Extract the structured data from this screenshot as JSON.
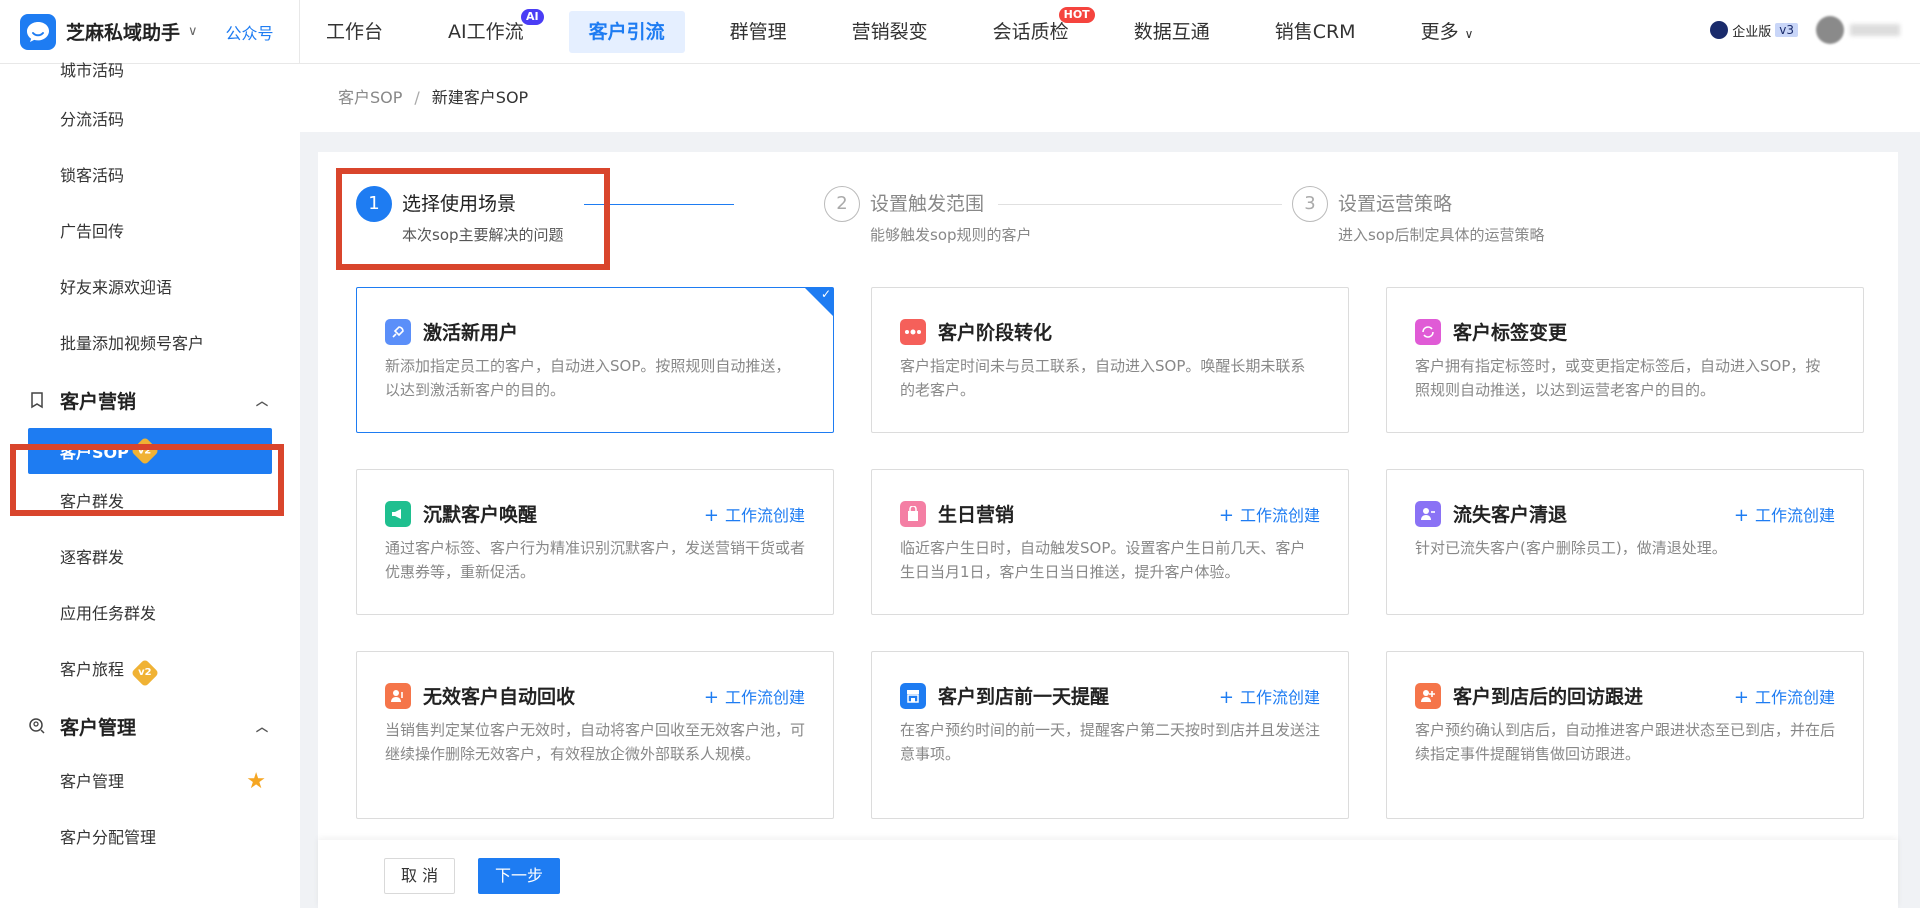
{
  "header": {
    "app_name": "芝麻私域助手",
    "public_link": "公众号",
    "nav": [
      {
        "label": "工作台"
      },
      {
        "label": "AI工作流",
        "badge": "AI"
      },
      {
        "label": "客户引流",
        "active": true
      },
      {
        "label": "群管理"
      },
      {
        "label": "营销裂变"
      },
      {
        "label": "会话质检",
        "badge": "HOT"
      },
      {
        "label": "数据互通"
      },
      {
        "label": "销售CRM"
      },
      {
        "label": "更多"
      }
    ],
    "edition": "企业版",
    "version": "v3"
  },
  "sidebar": {
    "top_items": [
      "城市活码",
      "分流活码",
      "锁客活码",
      "广告回传",
      "好友来源欢迎语",
      "批量添加视频号客户"
    ],
    "group_marketing": "客户营销",
    "active_item": "客户SOP",
    "active_badge": "v2",
    "marketing_items": [
      "客户群发",
      "逐客群发",
      "应用任务群发"
    ],
    "journey": "客户旅程",
    "journey_badge": "v2",
    "group_manage": "客户管理",
    "manage_items": [
      "客户管理",
      "客户分配管理"
    ]
  },
  "breadcrumb": {
    "parent": "客户SOP",
    "separator": "/",
    "current": "新建客户SOP"
  },
  "steps": [
    {
      "num": "1",
      "title": "选择使用场景",
      "desc": "本次sop主要解决的问题"
    },
    {
      "num": "2",
      "title": "设置触发范围",
      "desc": "能够触发sop规则的客户"
    },
    {
      "num": "3",
      "title": "设置运营策略",
      "desc": "进入sop后制定具体的运营策略"
    }
  ],
  "workflow_label": "工作流创建",
  "cards": [
    {
      "title": "激活新用户",
      "desc": "新添加指定员工的客户，自动进入SOP。按照规则自动推送，以达到激活新客户的目的。",
      "icon": "rocket-icon",
      "color": "#5b8ff9"
    },
    {
      "title": "客户阶段转化",
      "desc": "客户指定时间未与员工联系，自动进入SOP。唤醒长期未联系的老客户。",
      "icon": "stage-icon",
      "color": "#f5605a"
    },
    {
      "title": "客户标签变更",
      "desc": "客户拥有指定标签时，或变更指定标签后，自动进入SOP，按照规则自动推送，以达到运营老客户的目的。",
      "icon": "tag-change-icon",
      "color": "#e05bd6"
    },
    {
      "title": "沉默客户唤醒",
      "desc": "通过客户标签、客户行为精准识别沉默客户，发送营销干货或者优惠券等，重新促活。",
      "icon": "megaphone-icon",
      "color": "#1fbf8f"
    },
    {
      "title": "生日营销",
      "desc": "临近客户生日时，自动触发SOP。设置客户生日前几天、客户生日当月1日，客户生日当日推送，提升客户体验。",
      "icon": "gift-bag-icon",
      "color": "#f47fa4"
    },
    {
      "title": "流失客户清退",
      "desc": "针对已流失客户(客户删除员工)，做清退处理。",
      "icon": "user-remove-icon",
      "color": "#8a72f5"
    },
    {
      "title": "无效客户自动回收",
      "desc": "当销售判定某位客户无效时，自动将客户回收至无效客户池，可继续操作删除无效客户，有效程放企微外部联系人规模。",
      "icon": "recycle-icon",
      "color": "#f5754a"
    },
    {
      "title": "客户到店前一天提醒",
      "desc": "在客户预约时间的前一天，提醒客户第二天按时到店并且发送注意事项。",
      "icon": "store-icon",
      "color": "#1e7cf2"
    },
    {
      "title": "客户到店后的回访跟进",
      "desc": "客户预约确认到店后，自动推进客户跟进状态至已到店，并在后续指定事件提醒销售做回访跟进。",
      "icon": "user-follow-icon",
      "color": "#f5754a"
    }
  ],
  "footer": {
    "cancel": "取 消",
    "next": "下一步"
  }
}
